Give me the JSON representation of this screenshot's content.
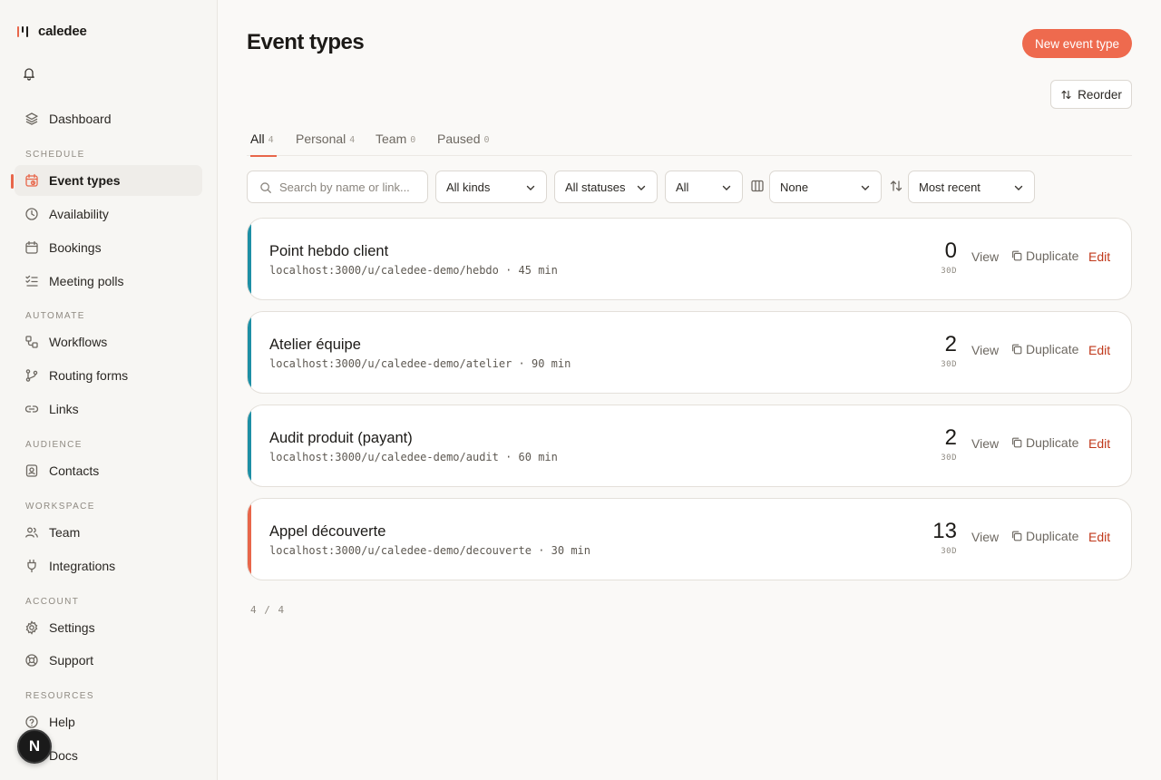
{
  "brand": {
    "name": "caledee"
  },
  "sidebar": {
    "dashboard": "Dashboard",
    "sections": {
      "schedule": "SCHEDULE",
      "automate": "AUTOMATE",
      "audience": "AUDIENCE",
      "workspace": "WORKSPACE",
      "account": "ACCOUNT",
      "resources": "RESOURCES"
    },
    "items": {
      "event_types": "Event types",
      "availability": "Availability",
      "bookings": "Bookings",
      "meeting_polls": "Meeting polls",
      "workflows": "Workflows",
      "routing_forms": "Routing forms",
      "links": "Links",
      "contacts": "Contacts",
      "team": "Team",
      "integrations": "Integrations",
      "settings": "Settings",
      "support": "Support",
      "help": "Help",
      "docs": "Docs"
    },
    "active_item": "event_types",
    "avatar_letter": "N"
  },
  "header": {
    "title": "Event types",
    "new_button": "New event type",
    "reorder_button": "Reorder"
  },
  "tabs": [
    {
      "label": "All",
      "count": "4",
      "active": true
    },
    {
      "label": "Personal",
      "count": "4"
    },
    {
      "label": "Team",
      "count": "0"
    },
    {
      "label": "Paused",
      "count": "0"
    }
  ],
  "filters": {
    "search_placeholder": "Search by name or link...",
    "kind": "All kinds",
    "status": "All statuses",
    "scope": "All",
    "group": "None",
    "sort": "Most recent"
  },
  "events": [
    {
      "title": "Point hebdo client",
      "url": "localhost:3000/u/caledee-demo/hebdo · 45 min",
      "count": "0",
      "period": "30D",
      "accent": "#1d8fa5"
    },
    {
      "title": "Atelier équipe",
      "url": "localhost:3000/u/caledee-demo/atelier · 90 min",
      "count": "2",
      "period": "30D",
      "accent": "#1d8fa5"
    },
    {
      "title": "Audit produit (payant)",
      "url": "localhost:3000/u/caledee-demo/audit · 60 min",
      "count": "2",
      "period": "30D",
      "accent": "#1d8fa5"
    },
    {
      "title": "Appel découverte",
      "url": "localhost:3000/u/caledee-demo/decouverte · 30 min",
      "count": "13",
      "period": "30D",
      "accent": "#e8664a"
    }
  ],
  "card_actions": {
    "view": "View",
    "duplicate": "Duplicate",
    "edit": "Edit"
  },
  "pager": "4 / 4",
  "colors": {
    "accent": "#ee6a4e",
    "edit": "#c0391b"
  }
}
